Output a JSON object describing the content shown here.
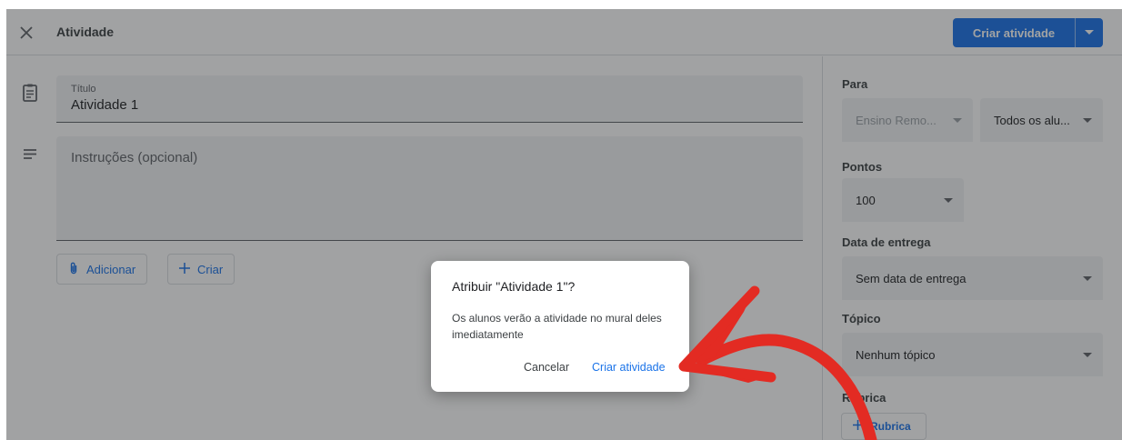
{
  "header": {
    "title": "Atividade",
    "primary_button": "Criar atividade"
  },
  "editor": {
    "title_label": "Título",
    "title_value": "Atividade 1",
    "instructions_placeholder": "Instruções (opcional)",
    "add_label": "Adicionar",
    "create_label": "Criar"
  },
  "sidebar": {
    "for_label": "Para",
    "class_value": "Ensino Remo...",
    "students_value": "Todos os alu...",
    "points_label": "Pontos",
    "points_value": "100",
    "due_label": "Data de entrega",
    "due_value": "Sem data de entrega",
    "topic_label": "Tópico",
    "topic_value": "Nenhum tópico",
    "rubric_label": "Rubrica",
    "rubric_button": "Rubrica"
  },
  "dialog": {
    "title": "Atribuir \"Atividade 1\"?",
    "body": "Os alunos verão a atividade no mural deles imediatamente",
    "cancel": "Cancelar",
    "confirm": "Criar atividade"
  },
  "colors": {
    "accent": "#1a73e8",
    "annotation_arrow": "#e32b23"
  },
  "icons": [
    "close-icon",
    "assignment-icon",
    "notes-icon",
    "paperclip-icon",
    "plus-icon",
    "chevron-down-icon"
  ]
}
